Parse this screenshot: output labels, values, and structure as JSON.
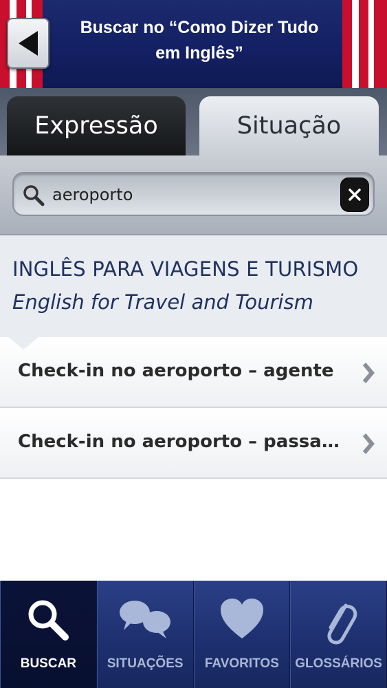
{
  "header": {
    "title_line1": "Buscar no “Como Dizer Tudo",
    "title_line2": "em Inglês”",
    "back_icon": "back-arrow-icon"
  },
  "tabs": [
    {
      "label": "Expressão",
      "selected": false
    },
    {
      "label": "Situação",
      "selected": true
    }
  ],
  "search": {
    "value": "aeroporto",
    "icon": "search-icon",
    "clear_icon": "clear-icon"
  },
  "category": {
    "title_pt": "INGLÊS PARA VIAGENS E TURISMO",
    "title_en": "English for Travel and Tourism"
  },
  "results": [
    {
      "label": "Check-in no aeroporto – agente"
    },
    {
      "label": "Check-in no aeroporto – passageiro"
    }
  ],
  "bottom_nav": [
    {
      "label": "BUSCAR",
      "icon": "search-icon",
      "active": true
    },
    {
      "label": "SITUAÇÕES",
      "icon": "speech-bubbles-icon",
      "active": false
    },
    {
      "label": "FAVORITOS",
      "icon": "heart-icon",
      "active": false
    },
    {
      "label": "GLOSSÁRIOS",
      "icon": "paperclip-icon",
      "active": false
    }
  ],
  "colors": {
    "header_blue": "#142064",
    "stripe_red": "#c8102e",
    "text_blue": "#1f3160",
    "nav_active": "#0b1238"
  }
}
